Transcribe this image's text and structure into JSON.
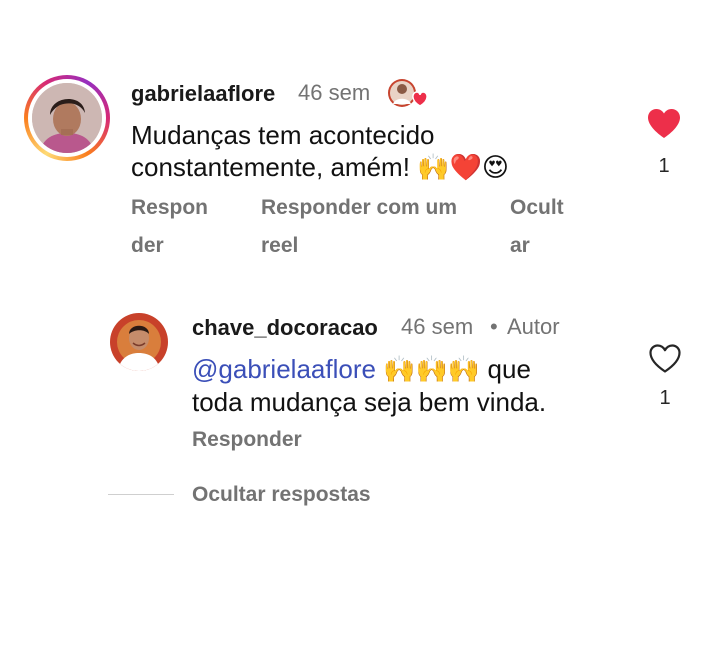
{
  "comment": {
    "username": "gabrielaaflore",
    "time": "46 sem",
    "text_line1": "Mudanças tem acontecido",
    "text_line2": "constantemente, amém! 🙌❤️😍",
    "actions": {
      "reply_part1": "Respon",
      "reply_part2": "der",
      "reply_reel_part1": "Responder com um",
      "reply_reel_part2": "reel",
      "hide_part1": "Ocult",
      "hide_part2": "ar"
    },
    "likes": "1",
    "liked": true
  },
  "reply": {
    "username": "chave_docoracao",
    "time": "46 sem",
    "separator": "•",
    "author_badge": "Autor",
    "mention": "@gabrielaaflore",
    "text_line1_rest": " 🙌🙌🙌 que",
    "text_line2": "toda mudança seja bem vinda.",
    "reply_label": "Responder",
    "likes": "1",
    "liked": false
  },
  "thread": {
    "hide_replies_label": "Ocultar respostas"
  },
  "colors": {
    "like_red": "#ed2f4a",
    "muted": "#737373",
    "mention_blue": "#3b4fb8"
  },
  "icons": {
    "heart_filled": "heart-filled-icon",
    "heart_outline": "heart-outline-icon",
    "creator_liked": "creator-liked-icon"
  }
}
